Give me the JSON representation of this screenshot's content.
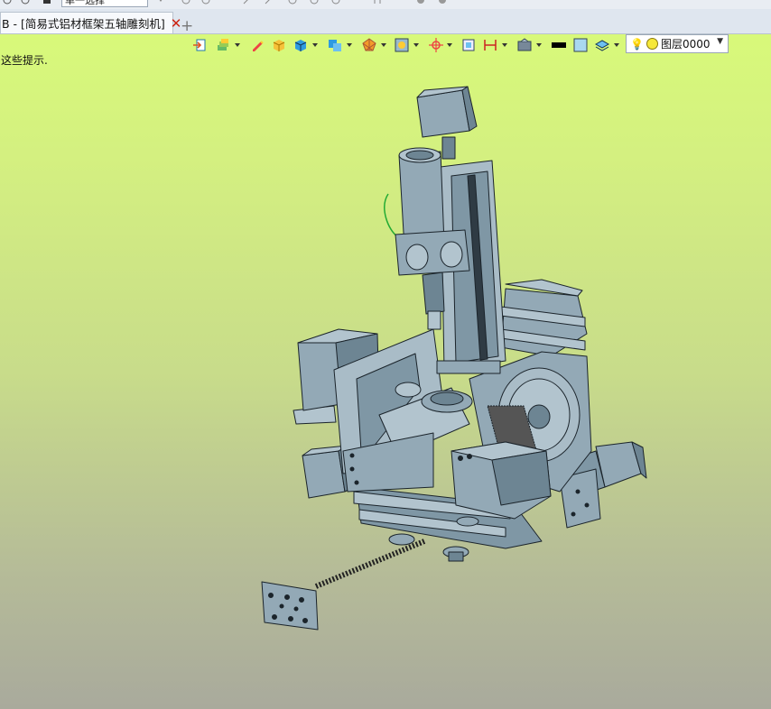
{
  "quick_access": {
    "mode_value": "单一选择"
  },
  "tabs": [
    {
      "label": "B - [简易式铝材框架五轴雕刻机]",
      "close": "✕"
    }
  ],
  "new_tab": "+",
  "hint_text": "这些提示.",
  "toolbar": {
    "icons": [
      "import-icon",
      "layers-icon",
      "sketch-pen-icon",
      "solid-box-icon",
      "solid-blue-icon",
      "view-cube-icon",
      "render-icon",
      "display-style-icon",
      "move-icon",
      "frame-icon",
      "dimension-icon",
      "view-manager-icon",
      "line-color-swatch",
      "fill-color-swatch",
      "layer-stack-icon"
    ],
    "layer_combo": {
      "value": "图层0000"
    }
  },
  "colors": {
    "model": "#93a9b6",
    "model_dark": "#6d8593",
    "edge": "#1b242b"
  }
}
